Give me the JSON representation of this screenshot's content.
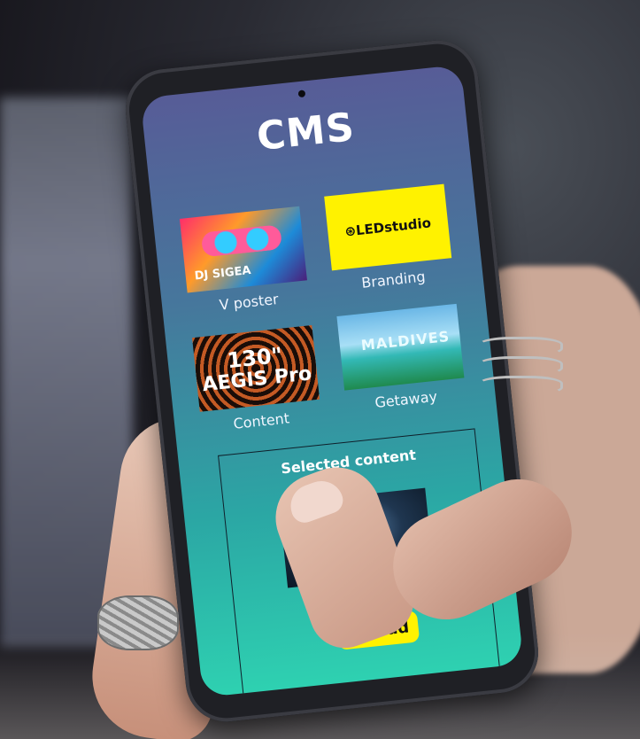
{
  "app": {
    "title": "CMS"
  },
  "tiles": [
    {
      "label": "V poster",
      "image_text": "DJ SIGEA"
    },
    {
      "label": "Branding",
      "image_text": "⊛LEDstudio"
    },
    {
      "label": "Content",
      "image_text_line1": "130\"",
      "image_text_line2": "AEGIS Pro"
    },
    {
      "label": "Getaway",
      "image_text": "MALDIVES"
    }
  ],
  "selected": {
    "label": "Selected content",
    "upload_label": "Upload"
  },
  "colors": {
    "accent_yellow": "#fff200",
    "screen_top": "#575c97",
    "screen_bottom": "#2ed1b1"
  }
}
